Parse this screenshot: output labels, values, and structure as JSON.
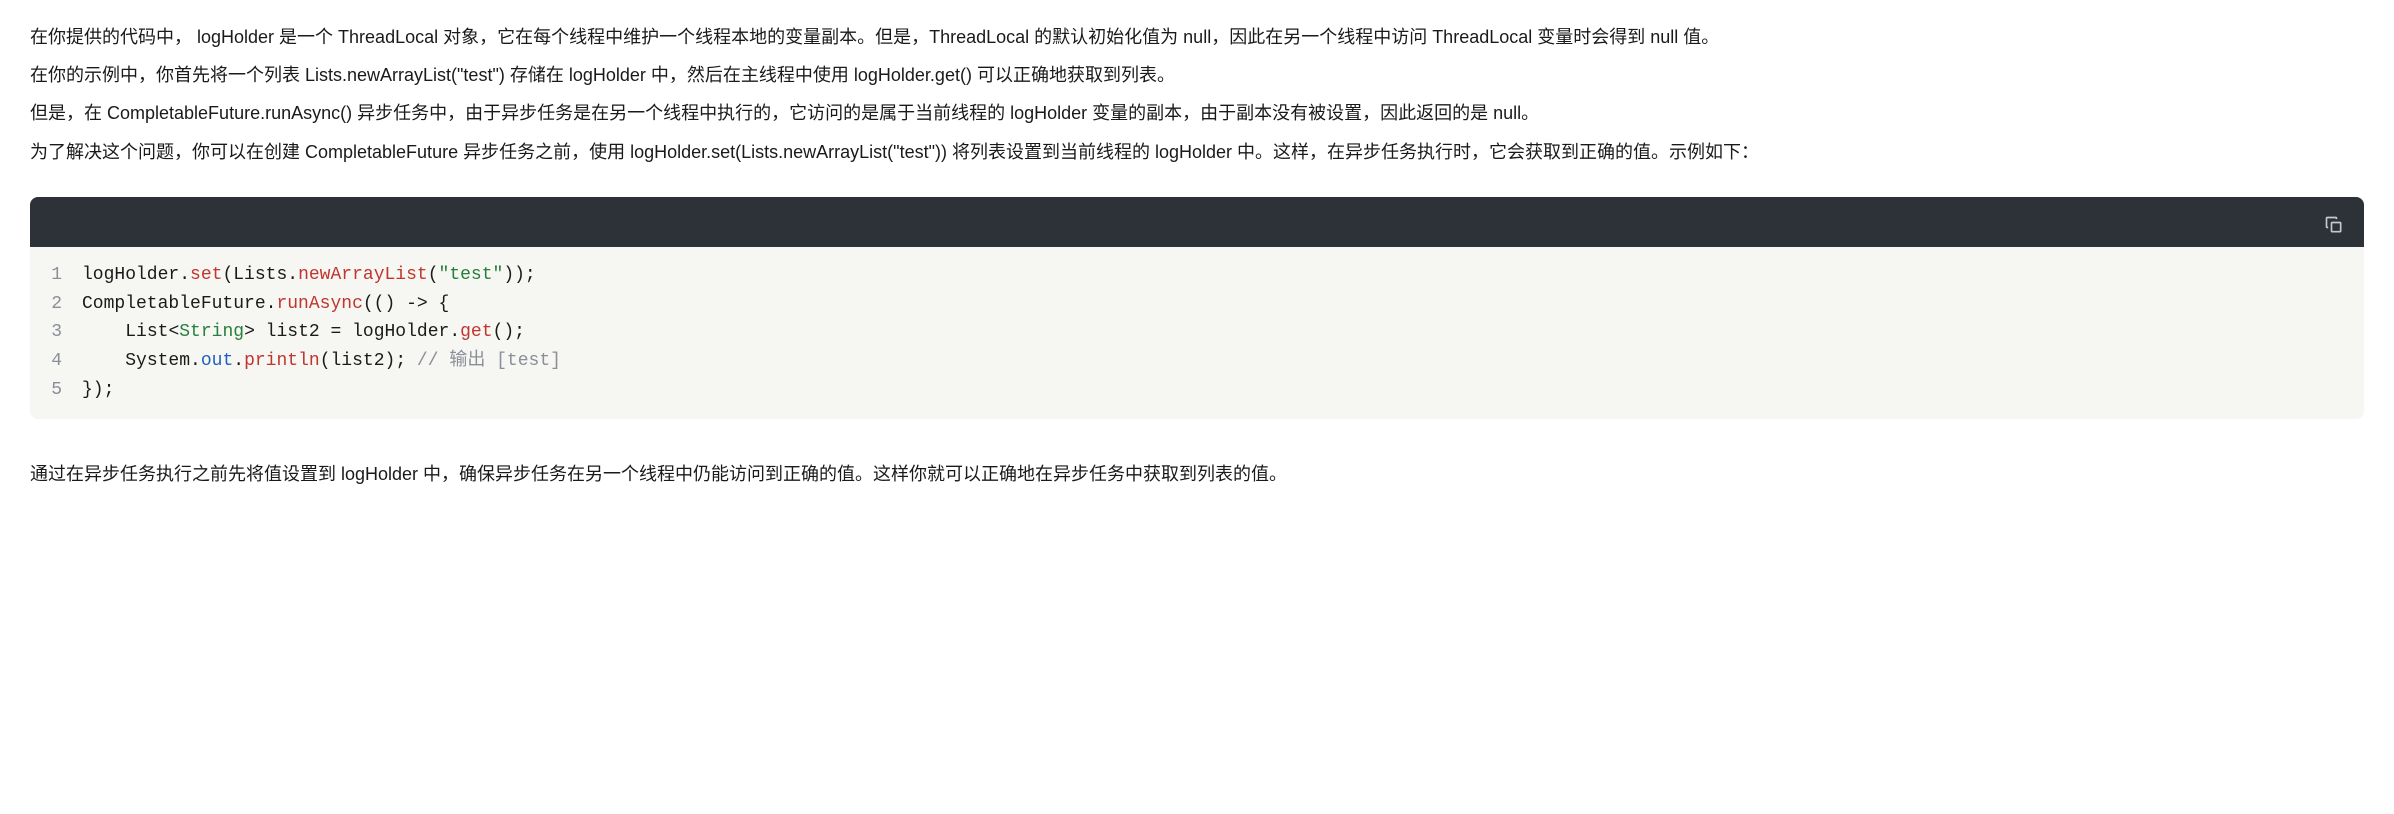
{
  "paragraphs": {
    "p1": "在你提供的代码中， logHolder 是一个 ThreadLocal 对象，它在每个线程中维护一个线程本地的变量副本。但是，ThreadLocal 的默认初始化值为 null，因此在另一个线程中访问 ThreadLocal 变量时会得到 null 值。",
    "p2": "在你的示例中，你首先将一个列表 Lists.newArrayList(\"test\") 存储在 logHolder 中，然后在主线程中使用 logHolder.get() 可以正确地获取到列表。",
    "p3": "但是，在 CompletableFuture.runAsync() 异步任务中，由于异步任务是在另一个线程中执行的，它访问的是属于当前线程的 logHolder 变量的副本，由于副本没有被设置，因此返回的是 null。",
    "p4": "为了解决这个问题，你可以在创建 CompletableFuture 异步任务之前，使用 logHolder.set(Lists.newArrayList(\"test\")) 将列表设置到当前线程的 logHolder 中。这样，在异步任务执行时，它会获取到正确的值。示例如下：",
    "footer": "通过在异步任务执行之前先将值设置到 logHolder 中，确保异步任务在另一个线程中仍能访问到正确的值。这样你就可以正确地在异步任务中获取到列表的值。"
  },
  "code": {
    "lines": [
      {
        "num": "1"
      },
      {
        "num": "2"
      },
      {
        "num": "3"
      },
      {
        "num": "4"
      },
      {
        "num": "5"
      }
    ],
    "tokens": {
      "l1_logHolder": "logHolder",
      "l1_set": "set",
      "l1_Lists": "Lists",
      "l1_newArrayList": "newArrayList",
      "l1_test": "\"test\"",
      "l2_CompletableFuture": "CompletableFuture",
      "l2_runAsync": "runAsync",
      "l3_List": "List",
      "l3_String": "String",
      "l3_list2": "list2",
      "l3_logHolder": "logHolder",
      "l3_get": "get",
      "l4_System": "System",
      "l4_out": "out",
      "l4_println": "println",
      "l4_list2": "list2",
      "l4_comment": "// 输出 [test]"
    }
  }
}
